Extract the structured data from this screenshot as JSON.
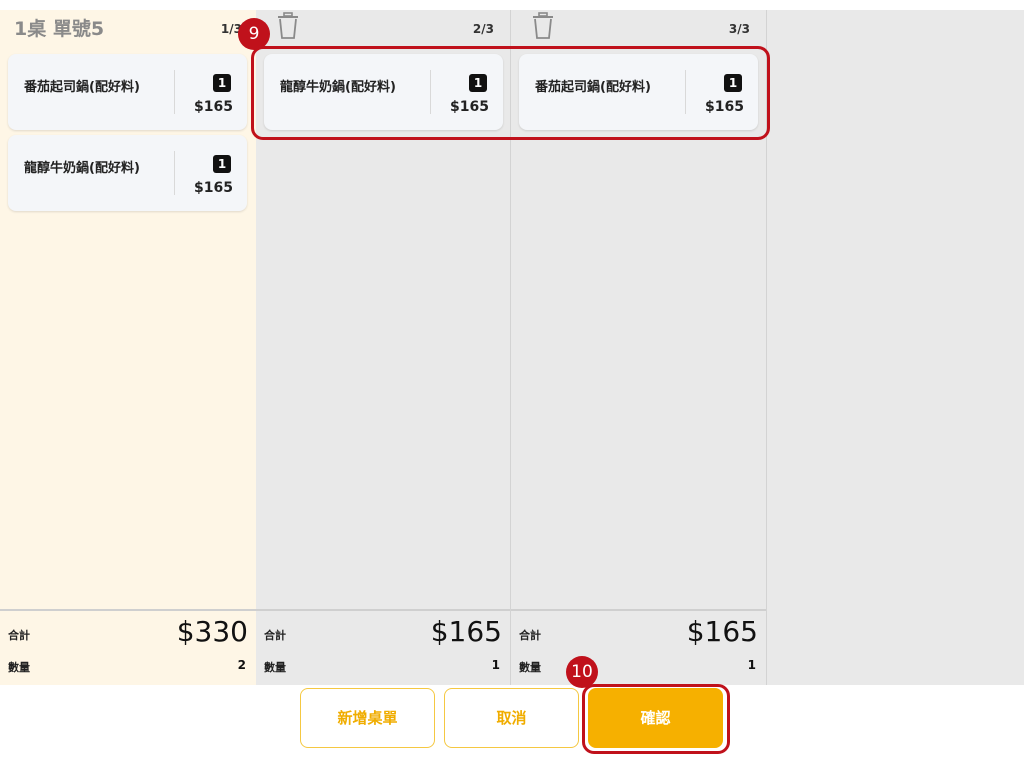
{
  "columns": [
    {
      "title": "1桌 單號5",
      "pager": "1/3",
      "items": [
        {
          "name": "番茄起司鍋(配好料)",
          "qty": "1",
          "price": "$165"
        },
        {
          "name": "龍醇牛奶鍋(配好料)",
          "qty": "1",
          "price": "$165"
        }
      ],
      "total_label": "合計",
      "total": "$330",
      "count_label": "數量",
      "count": "2"
    },
    {
      "pager": "2/3",
      "items": [
        {
          "name": "龍醇牛奶鍋(配好料)",
          "qty": "1",
          "price": "$165"
        }
      ],
      "total_label": "合計",
      "total": "$165",
      "count_label": "數量",
      "count": "1"
    },
    {
      "pager": "3/3",
      "items": [
        {
          "name": "番茄起司鍋(配好料)",
          "qty": "1",
          "price": "$165"
        }
      ],
      "total_label": "合計",
      "total": "$165",
      "count_label": "數量",
      "count": "1"
    }
  ],
  "buttons": {
    "new_table": "新增桌單",
    "cancel": "取消",
    "confirm": "確認"
  },
  "annotations": {
    "step9": "9",
    "step10": "10"
  },
  "colors": {
    "accent": "#f6b000",
    "highlight": "#c0111b",
    "first_column_bg": "#fef6e6",
    "column_bg": "#e9e9e9"
  }
}
